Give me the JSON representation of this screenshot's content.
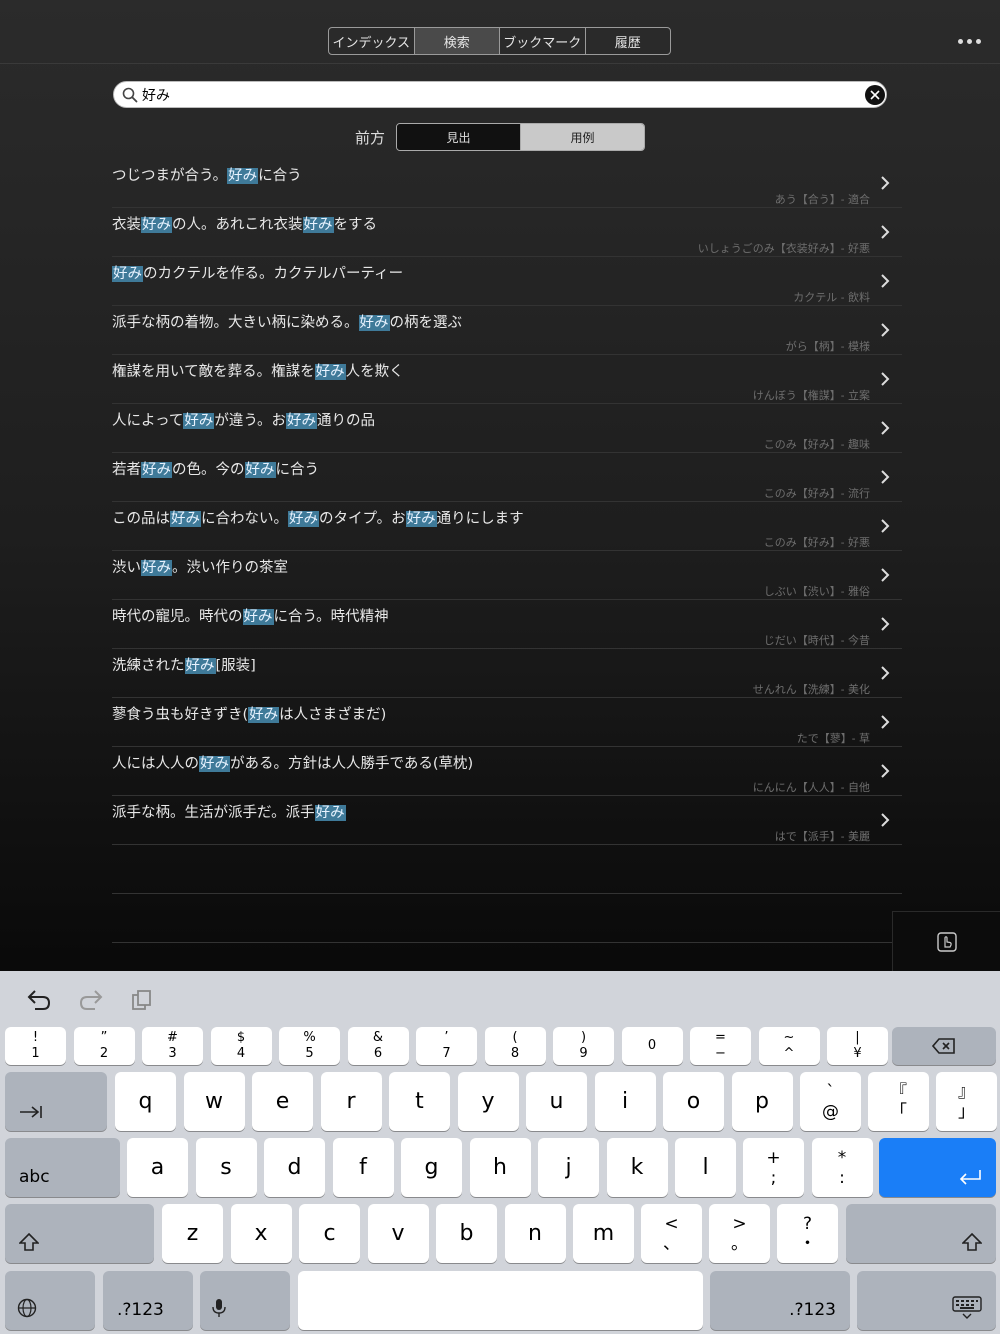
{
  "tabs": [
    {
      "label": "インデックス",
      "active": false
    },
    {
      "label": "検索",
      "active": true
    },
    {
      "label": "ブックマーク",
      "active": false
    },
    {
      "label": "履歴",
      "active": false
    }
  ],
  "search": {
    "value": "好み"
  },
  "direction": {
    "label": "前方",
    "options": [
      {
        "label": "見出",
        "active": false
      },
      {
        "label": "用例",
        "active": true
      }
    ]
  },
  "results": [
    {
      "parts": [
        "つじつまが合う。",
        "好み",
        "に合う"
      ],
      "source": "あう【合う】- 適合"
    },
    {
      "parts": [
        "衣装",
        "好み",
        "の人。あれこれ衣装",
        "好み",
        "をする"
      ],
      "source": "いしょうごのみ【衣装好み】- 好悪"
    },
    {
      "parts": [
        "",
        "好み",
        "のカクテルを作る。カクテルパーティー"
      ],
      "source": "カクテル - 飲料"
    },
    {
      "parts": [
        "派手な柄の着物。大きい柄に染める。",
        "好み",
        "の柄を選ぶ"
      ],
      "source": "がら【柄】- 模様"
    },
    {
      "parts": [
        "権謀を用いて敵を葬る。権謀を",
        "好み",
        "人を欺く"
      ],
      "source": "けんぼう【権謀】- 立案"
    },
    {
      "parts": [
        "人によって",
        "好み",
        "が違う。お",
        "好み",
        "通りの品"
      ],
      "source": "このみ【好み】- 趣味"
    },
    {
      "parts": [
        "若者",
        "好み",
        "の色。今の",
        "好み",
        "に合う"
      ],
      "source": "このみ【好み】- 流行"
    },
    {
      "parts": [
        "この品は",
        "好み",
        "に合わない。",
        "好み",
        "のタイプ。お",
        "好み",
        "通りにします"
      ],
      "source": "このみ【好み】- 好悪"
    },
    {
      "parts": [
        "渋い",
        "好み",
        "。渋い作りの茶室"
      ],
      "source": "しぶい【渋い】- 雅俗"
    },
    {
      "parts": [
        "時代の寵児。時代の",
        "好み",
        "に合う。時代精神"
      ],
      "source": "じだい【時代】- 今昔"
    },
    {
      "parts": [
        "洗練された",
        "好み",
        "[服装]"
      ],
      "source": "せんれん【洗練】- 美化"
    },
    {
      "parts": [
        "蓼食う虫も好きずき(",
        "好み",
        "は人さまざまだ)"
      ],
      "source": "たで【蓼】- 草"
    },
    {
      "parts": [
        "人には人人の",
        "好み",
        "がある。方針は人人勝手である(草枕)"
      ],
      "source": "にんにん【人人】- 自他"
    },
    {
      "parts": [
        "派手な柄。生活が派手だ。派手",
        "好み",
        ""
      ],
      "source": "はで【派手】- 美麗"
    }
  ],
  "keyboard": {
    "numrow": [
      {
        "t": "!",
        "b": "1"
      },
      {
        "t": "”",
        "b": "2"
      },
      {
        "t": "#",
        "b": "3"
      },
      {
        "t": "$",
        "b": "4"
      },
      {
        "t": "%",
        "b": "5"
      },
      {
        "t": "&",
        "b": "6"
      },
      {
        "t": "’",
        "b": "7"
      },
      {
        "t": "(",
        "b": "8"
      },
      {
        "t": ")",
        "b": "9"
      },
      {
        "t": "",
        "b": "0"
      },
      {
        "t": "=",
        "b": "−"
      },
      {
        "t": "~",
        "b": "^"
      },
      {
        "t": "|",
        "b": "¥"
      }
    ],
    "row_q": [
      "q",
      "w",
      "e",
      "r",
      "t",
      "y",
      "u",
      "i",
      "o",
      "p"
    ],
    "row_q_extra": [
      {
        "t": "`",
        "b": "@"
      },
      {
        "t": "『",
        "b": "「"
      },
      {
        "t": "』",
        "b": "」"
      }
    ],
    "row_a": [
      "a",
      "s",
      "d",
      "f",
      "g",
      "h",
      "j",
      "k",
      "l"
    ],
    "row_a_extra": [
      {
        "t": "+",
        "b": ";"
      },
      {
        "t": "*",
        "b": ":"
      }
    ],
    "row_z": [
      "z",
      "x",
      "c",
      "v",
      "b",
      "n",
      "m"
    ],
    "row_z_extra": [
      {
        "t": "<",
        "b": "、"
      },
      {
        "t": ">",
        "b": "。"
      },
      {
        "t": "?",
        "b": "・"
      }
    ],
    "abc_label": "abc",
    "num_label": ".?123"
  }
}
